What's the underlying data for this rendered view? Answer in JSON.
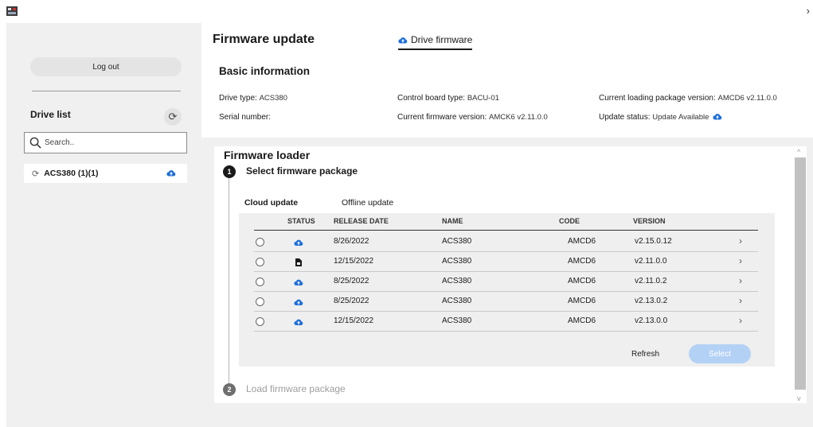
{
  "app": {
    "icon": "app-logo-icon",
    "chevron": "›"
  },
  "sidebar": {
    "logout_label": "Log out",
    "drive_list_title": "Drive list",
    "refresh_glyph": "⟳",
    "search_placeholder": "Search..",
    "drives": [
      {
        "label": "ACS380 (1)(1)",
        "status_icon": "cloud-icon"
      }
    ]
  },
  "header": {
    "title": "Firmware update",
    "tab_label": "Drive firmware"
  },
  "basic_info": {
    "title": "Basic information",
    "drive_type_label": "Drive type:",
    "drive_type_value": "ACS380",
    "serial_label": "Serial number:",
    "serial_value": "",
    "control_board_label": "Control board type:",
    "control_board_value": "BACU-01",
    "fw_version_label": "Current firmware version:",
    "fw_version_value": "AMCK6 v2.11.0.0",
    "loading_pkg_label": "Current loading package version:",
    "loading_pkg_value": "AMCD6 v2.11.0.0",
    "update_status_label": "Update status:",
    "update_status_value": "Update Available"
  },
  "loader": {
    "title": "Firmware loader",
    "step1_number": "1",
    "step1_label": "Select firmware package",
    "step2_number": "2",
    "step2_label": "Load firmware package",
    "tabs": {
      "cloud": "Cloud update",
      "offline": "Offline update"
    },
    "columns": {
      "status": "STATUS",
      "release_date": "RELEASE DATE",
      "name": "NAME",
      "code": "CODE",
      "version": "VERSION"
    },
    "rows": [
      {
        "status": "cloud",
        "date": "8/26/2022",
        "name": "ACS380",
        "code": "AMCD6",
        "version": "v2.15.0.12"
      },
      {
        "status": "local",
        "date": "12/15/2022",
        "name": "ACS380",
        "code": "AMCD6",
        "version": "v2.11.0.0"
      },
      {
        "status": "cloud",
        "date": "8/25/2022",
        "name": "ACS380",
        "code": "AMCD6",
        "version": "v2.11.0.2"
      },
      {
        "status": "cloud",
        "date": "8/25/2022",
        "name": "ACS380",
        "code": "AMCD6",
        "version": "v2.13.0.2"
      },
      {
        "status": "cloud",
        "date": "12/15/2022",
        "name": "ACS380",
        "code": "AMCD6",
        "version": "v2.13.0.0"
      }
    ],
    "row_arrow": "›",
    "refresh_label": "Refresh",
    "select_label": "Select"
  },
  "colors": {
    "accent_blue": "#1f6fdb",
    "select_disabled": "#b3d1f5",
    "panel_gray": "#f0f0f0"
  }
}
